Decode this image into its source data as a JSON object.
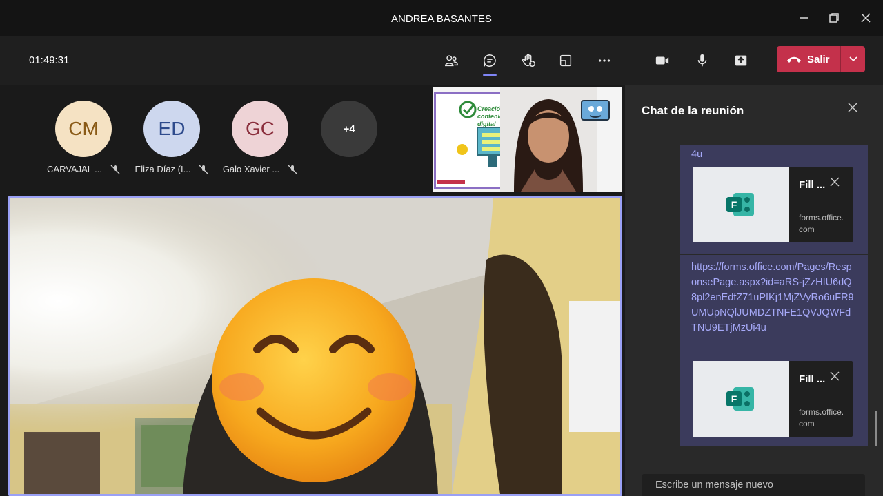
{
  "window": {
    "title": "ANDREA BASANTES"
  },
  "toolbar": {
    "timer": "01:49:31",
    "leave_label": "Salir"
  },
  "participants": [
    {
      "initials": "CM",
      "name": "CARVAJAL ...",
      "bg": "#f5e2c3",
      "fg": "#8a5a16"
    },
    {
      "initials": "ED",
      "name": "Eliza Díaz (I...",
      "bg": "#cdd7ee",
      "fg": "#2e4b8c"
    },
    {
      "initials": "GC",
      "name": "Galo Xavier ...",
      "bg": "#eed3d6",
      "fg": "#8a2e3c"
    }
  ],
  "overflow": {
    "label": "+4"
  },
  "pip": {
    "slide_text": "Creación de contenido digital"
  },
  "chat": {
    "title": "Chat de la reunión",
    "msg1_tail": "4u",
    "msg2_link": "https://forms.office.com/Pages/ResponsePage.aspx?id=aRS-jZzHIU6dQ8pl2enEdfZ71uPIKj1MjZVyRo6uFR9UMUpNQlJUMDZTNFE1QVJQWFdTNU9ETjMzUi4u",
    "cards": [
      {
        "title": "Fill ...",
        "domain": "forms.office.com"
      },
      {
        "title": "Fill ...",
        "domain": "forms.office.com"
      }
    ],
    "compose_placeholder": "Escribe un mensaje nuevo"
  },
  "colors": {
    "accent": "#7f85f5",
    "leave": "#c4314b",
    "link": "#a6a9f8"
  }
}
